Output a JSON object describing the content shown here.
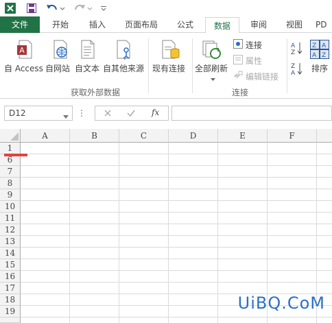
{
  "qat": {
    "app_icon": "excel-logo-icon",
    "save_icon": "save-icon",
    "undo_icon": "undo-icon",
    "redo_icon": "redo-icon",
    "customize_icon": "customize-qat-icon"
  },
  "tabs": [
    {
      "label": "文件"
    },
    {
      "label": "开始"
    },
    {
      "label": "插入"
    },
    {
      "label": "页面布局"
    },
    {
      "label": "公式"
    },
    {
      "label": "数据"
    },
    {
      "label": "审阅"
    },
    {
      "label": "视图"
    },
    {
      "label": "PD"
    }
  ],
  "ribbon": {
    "external_group": {
      "label": "获取外部数据",
      "buttons": [
        {
          "label": "自 Access",
          "icon": "access-db-icon"
        },
        {
          "label": "自网站",
          "icon": "web-globe-icon"
        },
        {
          "label": "自文本",
          "icon": "text-file-icon"
        },
        {
          "label": "自其他来源",
          "icon": "other-sources-icon"
        }
      ]
    },
    "existing_connections": {
      "label": "现有连接",
      "icon": "existing-connections-icon"
    },
    "connections_group": {
      "label": "连接",
      "refresh_all": "全部刷新",
      "connections": "连接",
      "properties": "属性",
      "edit_links": "编辑链接"
    },
    "sort_group": {
      "sort_az_icon": "sort-az-icon",
      "sort_za_icon": "sort-za-icon",
      "sort": "排序"
    }
  },
  "formula_bar": {
    "name_box": "D12",
    "fx_label": "fx",
    "formula": ""
  },
  "grid": {
    "columns": [
      "A",
      "B",
      "C",
      "D",
      "E",
      "F"
    ],
    "rows": [
      "1",
      "6",
      "7",
      "8",
      "9",
      "10",
      "11",
      "12",
      "13",
      "14",
      "15",
      "16",
      "17",
      "18",
      "19"
    ]
  },
  "watermark": "UiBQ.CoM",
  "colors": {
    "accent": "#217346",
    "marker": "#e8403a"
  }
}
